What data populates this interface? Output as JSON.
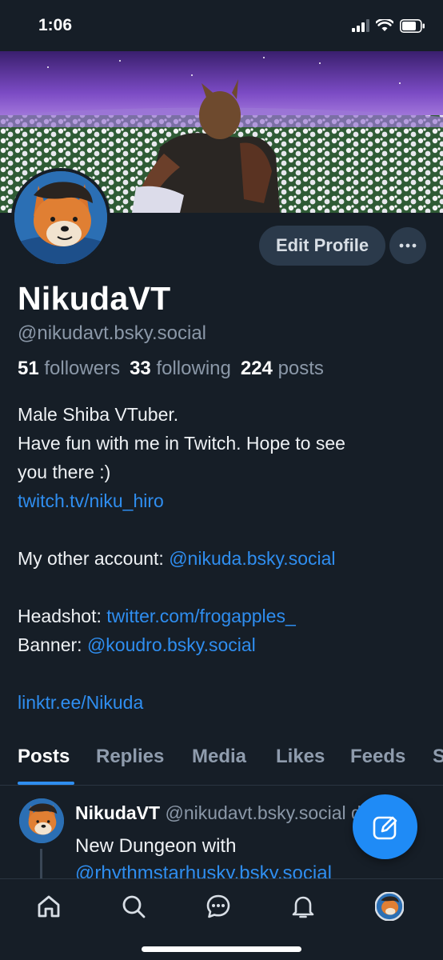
{
  "status_bar": {
    "time": "1:06"
  },
  "profile": {
    "display_name": "NikudaVT",
    "handle": "@nikudavt.bsky.social",
    "edit_button": "Edit Profile",
    "more_button": "···",
    "stats": {
      "followers_count": "51",
      "followers_label": "followers",
      "following_count": "33",
      "following_label": "following",
      "posts_count": "224",
      "posts_label": "posts"
    },
    "bio": {
      "line1": "Male Shiba VTuber.",
      "line2": "Have fun with me in Twitch. Hope to see",
      "line3": "you there :)",
      "link1": "twitch.tv/niku_hiro",
      "other_account_label": "My other account: ",
      "other_account_link": "@nikuda.bsky.social",
      "headshot_label": "Headshot: ",
      "headshot_link": "twitter.com/frogapples_",
      "banner_label": "Banner: ",
      "banner_link": "@koudro.bsky.social",
      "linktree": "linktr.ee/Nikuda"
    }
  },
  "tabs": [
    {
      "label": "Posts",
      "active": true
    },
    {
      "label": "Replies"
    },
    {
      "label": "Media"
    },
    {
      "label": "Likes"
    },
    {
      "label": "Feeds"
    },
    {
      "label": "S"
    }
  ],
  "post": {
    "author": "NikudaVT",
    "handle": "@nikudavt.bsky.social",
    "time_suffix": "d",
    "text_line1": "New Dungeon with",
    "text_link": "@rhythmstarhusky.bsky.social"
  },
  "icons": {
    "compose": "compose-icon",
    "home": "home-icon",
    "search": "search-icon",
    "chat": "chat-icon",
    "notifications": "bell-icon",
    "profile": "profile-avatar-icon"
  },
  "colors": {
    "background": "#161e27",
    "accent": "#2f8ef0",
    "fab": "#1f8bf6",
    "button": "#2b3a4b",
    "muted_text": "#8b98a8"
  }
}
